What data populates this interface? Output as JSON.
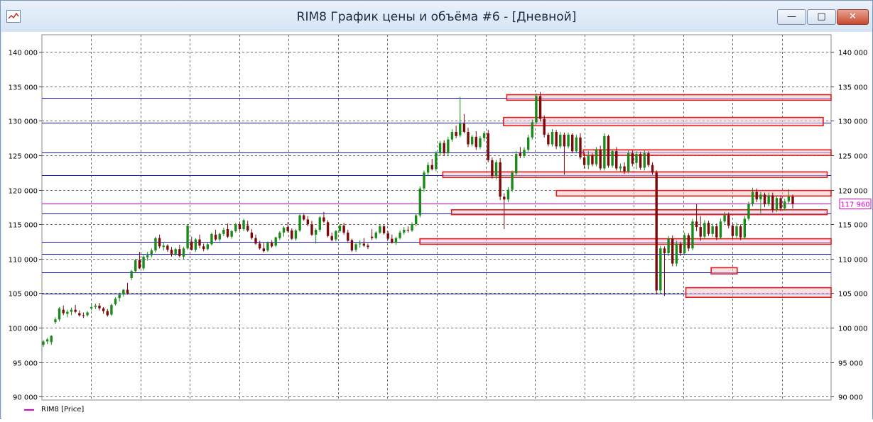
{
  "window": {
    "title": "RIM8 График цены и объёма #6 - [Дневной]",
    "buttons": {
      "minimize": "—",
      "maximize": "□",
      "close": "✕"
    }
  },
  "legend": {
    "label": "RIM8 [Price]",
    "color": "#e000c8"
  },
  "chart_data": {
    "type": "candlestick",
    "ylim": [
      89500,
      142500
    ],
    "y_ticks": [
      90000,
      95000,
      100000,
      105000,
      110000,
      115000,
      120000,
      125000,
      130000,
      135000,
      140000
    ],
    "y_tick_labels": [
      "90 000",
      "95 000",
      "100 000",
      "105 000",
      "110 000",
      "115 000",
      "120 000",
      "125 000",
      "130 000",
      "135 000",
      "140 000"
    ],
    "last_price": 117960,
    "last_price_label": "117 960",
    "last_price_color": "#e000c8",
    "colors": {
      "up": "#1a8a1a",
      "down": "#7a0a0a",
      "level": "#1414c8",
      "zone_edge": "#e31b1b",
      "zone_fill": "#f3c9cf",
      "grid": "#6e6e6e"
    },
    "horizontal_levels": [
      133300,
      129700,
      125400,
      122100,
      116600,
      112400,
      110700,
      108000,
      104900
    ],
    "zones": [
      {
        "x0": 0.589,
        "x1": 1.0,
        "y0": 133000,
        "y1": 133800
      },
      {
        "x0": 0.585,
        "x1": 0.99,
        "y0": 129300,
        "y1": 130500
      },
      {
        "x0": 0.686,
        "x1": 1.0,
        "y0": 125000,
        "y1": 125800
      },
      {
        "x0": 0.508,
        "x1": 0.995,
        "y0": 121800,
        "y1": 122600
      },
      {
        "x0": 0.652,
        "x1": 1.0,
        "y0": 119100,
        "y1": 119900
      },
      {
        "x0": 0.519,
        "x1": 0.995,
        "y0": 116400,
        "y1": 117100
      },
      {
        "x0": 0.479,
        "x1": 1.0,
        "y0": 112100,
        "y1": 112900
      },
      {
        "x0": 0.848,
        "x1": 0.881,
        "y0": 107800,
        "y1": 108700
      },
      {
        "x0": 0.816,
        "x1": 1.0,
        "y0": 104400,
        "y1": 105800
      }
    ],
    "candles": [
      [
        97500,
        98200,
        97200,
        98000
      ],
      [
        98000,
        98500,
        97600,
        98300
      ],
      [
        97900,
        98900,
        97500,
        98800
      ],
      [
        100800,
        101500,
        100500,
        101200
      ],
      [
        101200,
        103000,
        100900,
        102800
      ],
      [
        102600,
        103200,
        101800,
        102100
      ],
      [
        102000,
        102600,
        101500,
        102300
      ],
      [
        102300,
        102900,
        101800,
        102600
      ],
      [
        102600,
        103300,
        102100,
        102300
      ],
      [
        102100,
        102500,
        101600,
        101800
      ],
      [
        101800,
        102200,
        101400,
        101700
      ],
      [
        101800,
        102400,
        101600,
        102200
      ],
      [
        102800,
        103400,
        102500,
        103000
      ],
      [
        103000,
        103500,
        102700,
        103200
      ],
      [
        103200,
        103600,
        102500,
        102800
      ],
      [
        102800,
        103000,
        102000,
        102400
      ],
      [
        102400,
        102700,
        101600,
        101800
      ],
      [
        101900,
        103500,
        101700,
        103300
      ],
      [
        103400,
        104400,
        103200,
        104200
      ],
      [
        104300,
        105100,
        103800,
        104800
      ],
      [
        104800,
        105600,
        104500,
        105500
      ],
      [
        105500,
        106500,
        104800,
        105000
      ],
      [
        107200,
        108400,
        106900,
        108200
      ],
      [
        108200,
        110000,
        107900,
        109800
      ],
      [
        109800,
        111000,
        108500,
        108600
      ],
      [
        108600,
        110500,
        108300,
        110300
      ],
      [
        110200,
        111000,
        109700,
        110500
      ],
      [
        110500,
        111500,
        110200,
        111200
      ],
      [
        111200,
        113200,
        110900,
        113000
      ],
      [
        113000,
        113500,
        111500,
        111800
      ],
      [
        111700,
        112300,
        111200,
        111900
      ],
      [
        111900,
        112100,
        111000,
        111300
      ],
      [
        111300,
        111700,
        110300,
        110600
      ],
      [
        110700,
        111600,
        110400,
        111400
      ],
      [
        111400,
        112000,
        110200,
        110400
      ],
      [
        110300,
        111700,
        109900,
        111500
      ],
      [
        111500,
        115000,
        111300,
        114800
      ],
      [
        112500,
        113200,
        111200,
        111300
      ],
      [
        111300,
        113000,
        111000,
        112800
      ],
      [
        112800,
        113500,
        111500,
        111900
      ],
      [
        111800,
        112200,
        111100,
        111400
      ],
      [
        111400,
        112300,
        111200,
        112100
      ],
      [
        112100,
        113800,
        111900,
        113600
      ],
      [
        113500,
        114200,
        112600,
        112800
      ],
      [
        112800,
        113800,
        112500,
        113600
      ],
      [
        113600,
        114500,
        113300,
        114200
      ],
      [
        114300,
        115100,
        113000,
        113200
      ],
      [
        113200,
        114200,
        112900,
        114000
      ],
      [
        114000,
        115200,
        113800,
        115000
      ],
      [
        115000,
        115400,
        114100,
        114300
      ],
      [
        114300,
        115800,
        114000,
        115600
      ],
      [
        114800,
        115500,
        113900,
        114100
      ],
      [
        113800,
        114300,
        112800,
        113000
      ],
      [
        113000,
        113500,
        112000,
        112200
      ],
      [
        112200,
        112600,
        111300,
        111500
      ],
      [
        111500,
        112300,
        110900,
        111100
      ],
      [
        111200,
        112500,
        111000,
        112300
      ],
      [
        112300,
        112700,
        111600,
        111800
      ],
      [
        111900,
        113200,
        111700,
        113100
      ],
      [
        113000,
        114000,
        112700,
        113800
      ],
      [
        113800,
        114700,
        113200,
        114500
      ],
      [
        114600,
        115300,
        113800,
        114000
      ],
      [
        114100,
        114400,
        112700,
        112900
      ],
      [
        112900,
        114300,
        112600,
        114100
      ],
      [
        114100,
        116500,
        113900,
        116300
      ],
      [
        116300,
        116600,
        115500,
        115700
      ],
      [
        115700,
        116200,
        114700,
        115000
      ],
      [
        115000,
        115500,
        113300,
        113500
      ],
      [
        113500,
        114400,
        112200,
        114200
      ],
      [
        114200,
        116200,
        113900,
        116000
      ],
      [
        116000,
        116800,
        115200,
        115400
      ],
      [
        115300,
        115600,
        113100,
        113300
      ],
      [
        113300,
        113800,
        112500,
        112700
      ],
      [
        112800,
        114200,
        112500,
        114000
      ],
      [
        114000,
        115000,
        113800,
        114800
      ],
      [
        114800,
        115200,
        113500,
        113800
      ],
      [
        113800,
        114200,
        112300,
        112600
      ],
      [
        112700,
        112900,
        111000,
        111200
      ],
      [
        111300,
        112300,
        111000,
        112100
      ],
      [
        112100,
        112700,
        111600,
        112200
      ],
      [
        112200,
        113000,
        111700,
        111900
      ],
      [
        111900,
        112200,
        111400,
        111700
      ],
      [
        113200,
        114300,
        112700,
        113000
      ],
      [
        113000,
        114000,
        112800,
        113800
      ],
      [
        113800,
        115000,
        113600,
        114700
      ],
      [
        114700,
        115000,
        113500,
        113700
      ],
      [
        113700,
        114000,
        112700,
        112900
      ],
      [
        112900,
        113500,
        112200,
        112300
      ],
      [
        112300,
        113200,
        112000,
        113000
      ],
      [
        113000,
        114100,
        112800,
        113800
      ],
      [
        113800,
        114600,
        113500,
        114200
      ],
      [
        114200,
        114700,
        113800,
        114100
      ],
      [
        114100,
        115300,
        113900,
        115000
      ],
      [
        115000,
        116500,
        114700,
        116300
      ],
      [
        116300,
        120500,
        116000,
        120200
      ],
      [
        120200,
        122800,
        119700,
        122500
      ],
      [
        122500,
        124000,
        122000,
        123600
      ],
      [
        123600,
        124500,
        122800,
        123000
      ],
      [
        123000,
        125600,
        122700,
        125300
      ],
      [
        125300,
        127100,
        125000,
        126800
      ],
      [
        126800,
        127200,
        124900,
        125300
      ],
      [
        125300,
        127700,
        125000,
        127300
      ],
      [
        127300,
        128800,
        127000,
        128400
      ],
      [
        128400,
        129300,
        127500,
        127800
      ],
      [
        127900,
        133500,
        127600,
        129600
      ],
      [
        129600,
        131000,
        128200,
        128400
      ],
      [
        128400,
        129000,
        126200,
        126600
      ],
      [
        126600,
        128000,
        126300,
        127700
      ],
      [
        127700,
        128500,
        125800,
        126200
      ],
      [
        126200,
        127800,
        125900,
        127500
      ],
      [
        127500,
        128500,
        127000,
        128200
      ],
      [
        128200,
        128700,
        124000,
        124300
      ],
      [
        124300,
        124700,
        121600,
        122000
      ],
      [
        122000,
        124300,
        121500,
        124000
      ],
      [
        124000,
        124600,
        118500,
        119000
      ],
      [
        119000,
        119500,
        114300,
        118600
      ],
      [
        118600,
        120400,
        118200,
        120000
      ],
      [
        120000,
        122800,
        119700,
        122500
      ],
      [
        122400,
        125600,
        122100,
        125200
      ],
      [
        125300,
        126200,
        124600,
        124900
      ],
      [
        124900,
        126200,
        124600,
        125800
      ],
      [
        125800,
        128000,
        125500,
        127600
      ],
      [
        127600,
        130200,
        127300,
        129800
      ],
      [
        129800,
        134000,
        129500,
        133600
      ],
      [
        133600,
        134200,
        129900,
        130300
      ],
      [
        130300,
        130800,
        127600,
        128000
      ],
      [
        128000,
        128300,
        126300,
        126600
      ],
      [
        126600,
        128800,
        126300,
        128400
      ],
      [
        128400,
        128700,
        125900,
        126300
      ],
      [
        126300,
        128400,
        126000,
        128000
      ],
      [
        128000,
        128300,
        122200,
        126300
      ],
      [
        126300,
        128300,
        126000,
        128000
      ],
      [
        128000,
        128200,
        125300,
        125600
      ],
      [
        125600,
        128000,
        125300,
        127600
      ],
      [
        127600,
        128200,
        124400,
        124700
      ],
      [
        124700,
        125500,
        123100,
        123600
      ],
      [
        123600,
        125600,
        123000,
        125000
      ],
      [
        125000,
        125300,
        123400,
        123700
      ],
      [
        123700,
        126200,
        123400,
        125800
      ],
      [
        125800,
        126400,
        122800,
        123100
      ],
      [
        123100,
        128200,
        122800,
        127800
      ],
      [
        127800,
        128000,
        123200,
        123500
      ],
      [
        123500,
        125800,
        123200,
        125600
      ],
      [
        125600,
        126200,
        122800,
        123100
      ],
      [
        123100,
        123800,
        122600,
        123400
      ],
      [
        123400,
        124000,
        122300,
        122700
      ],
      [
        122700,
        125700,
        122400,
        125300
      ],
      [
        125300,
        125700,
        123400,
        123800
      ],
      [
        123900,
        125600,
        123000,
        125200
      ],
      [
        125200,
        125500,
        122900,
        123200
      ],
      [
        123200,
        125800,
        122800,
        125300
      ],
      [
        125300,
        125600,
        123300,
        123600
      ],
      [
        123600,
        124000,
        122200,
        122500
      ],
      [
        122500,
        122800,
        104800,
        105400
      ],
      [
        105400,
        111900,
        104900,
        111500
      ],
      [
        111500,
        111800,
        104600,
        110800
      ],
      [
        110800,
        113300,
        110400,
        112900
      ],
      [
        112900,
        113400,
        108900,
        109300
      ],
      [
        109300,
        112600,
        108900,
        112200
      ],
      [
        112200,
        112500,
        110400,
        110800
      ],
      [
        110800,
        113800,
        110500,
        113400
      ],
      [
        113400,
        113700,
        111100,
        111500
      ],
      [
        111500,
        115800,
        111200,
        115400
      ],
      [
        115400,
        117900,
        114000,
        114600
      ],
      [
        114600,
        116200,
        112600,
        113200
      ],
      [
        113200,
        115600,
        112800,
        115200
      ],
      [
        115200,
        115500,
        113300,
        113600
      ],
      [
        113600,
        115100,
        113200,
        114700
      ],
      [
        114700,
        115100,
        112700,
        113100
      ],
      [
        113100,
        115800,
        112800,
        115400
      ],
      [
        115400,
        116800,
        115100,
        116300
      ],
      [
        116300,
        116700,
        114400,
        114800
      ],
      [
        114800,
        115100,
        112900,
        113300
      ],
      [
        113300,
        115200,
        113000,
        114700
      ],
      [
        114700,
        115000,
        112700,
        113100
      ],
      [
        113100,
        116200,
        112800,
        115800
      ],
      [
        115800,
        118300,
        115500,
        117900
      ],
      [
        117900,
        120300,
        117600,
        119700
      ],
      [
        119700,
        120200,
        118200,
        118600
      ],
      [
        118600,
        119700,
        116600,
        119300
      ],
      [
        119300,
        119600,
        117500,
        117900
      ],
      [
        117900,
        119600,
        117600,
        119200
      ],
      [
        119200,
        119600,
        116700,
        117100
      ],
      [
        117100,
        119200,
        116800,
        118800
      ],
      [
        118800,
        119200,
        116900,
        117300
      ],
      [
        117300,
        118700,
        117000,
        118300
      ],
      [
        118300,
        120100,
        118000,
        119000
      ],
      [
        119000,
        119300,
        117300,
        117960
      ]
    ]
  }
}
